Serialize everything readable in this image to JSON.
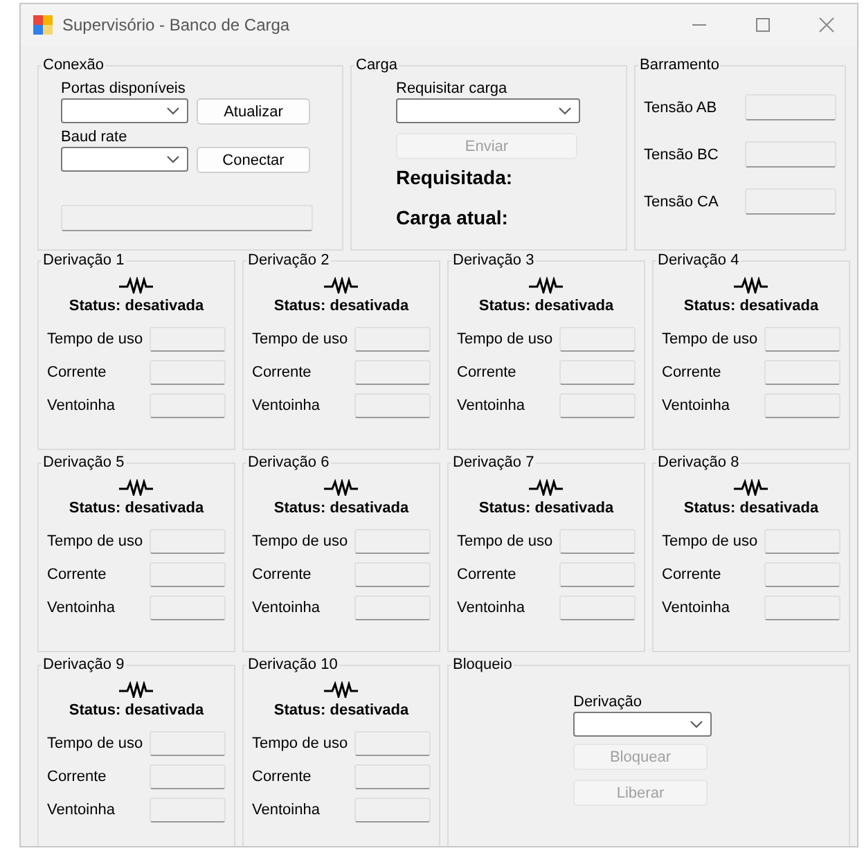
{
  "window": {
    "title": "Supervisório - Banco de Carga"
  },
  "connection": {
    "title": "Conexão",
    "ports_label": "Portas disponíveis",
    "baud_label": "Baud rate",
    "buttons": [
      {
        "label": "Atualizar",
        "disabled": false
      },
      {
        "label": "Conectar",
        "disabled": false
      }
    ]
  },
  "load": {
    "title": "Carga",
    "request_label": "Requisitar carga",
    "send_button": {
      "label": "Enviar",
      "disabled": true
    },
    "requested_label": "Requisitada:",
    "current_label": "Carga atual:"
  },
  "bus": {
    "title": "Barramento",
    "rows": [
      {
        "label": "Tensão AB"
      },
      {
        "label": "Tensão BC"
      },
      {
        "label": "Tensão CA"
      }
    ]
  },
  "branches": [
    {
      "title": "Derivação 1",
      "status": "Status: desativada",
      "fields": [
        "Tempo de uso",
        "Corrente",
        "Ventoinha"
      ]
    },
    {
      "title": "Derivação 2",
      "status": "Status: desativada",
      "fields": [
        "Tempo de uso",
        "Corrente",
        "Ventoinha"
      ]
    },
    {
      "title": "Derivação 3",
      "status": "Status: desativada",
      "fields": [
        "Tempo de uso",
        "Corrente",
        "Ventoinha"
      ]
    },
    {
      "title": "Derivação 4",
      "status": "Status: desativada",
      "fields": [
        "Tempo de uso",
        "Corrente",
        "Ventoinha"
      ]
    },
    {
      "title": "Derivação 5",
      "status": "Status: desativada",
      "fields": [
        "Tempo de uso",
        "Corrente",
        "Ventoinha"
      ]
    },
    {
      "title": "Derivação 6",
      "status": "Status: desativada",
      "fields": [
        "Tempo de uso",
        "Corrente",
        "Ventoinha"
      ]
    },
    {
      "title": "Derivação 7",
      "status": "Status: desativada",
      "fields": [
        "Tempo de uso",
        "Corrente",
        "Ventoinha"
      ]
    },
    {
      "title": "Derivação 8",
      "status": "Status: desativada",
      "fields": [
        "Tempo de uso",
        "Corrente",
        "Ventoinha"
      ]
    },
    {
      "title": "Derivação 9",
      "status": "Status: desativada",
      "fields": [
        "Tempo de uso",
        "Corrente",
        "Ventoinha"
      ]
    },
    {
      "title": "Derivação 10",
      "status": "Status: desativada",
      "fields": [
        "Tempo de uso",
        "Corrente",
        "Ventoinha"
      ]
    }
  ],
  "lock": {
    "title": "Bloqueio",
    "label": "Derivação",
    "buttons": [
      {
        "label": "Bloquear",
        "disabled": true
      },
      {
        "label": "Liberar",
        "disabled": true
      }
    ]
  }
}
